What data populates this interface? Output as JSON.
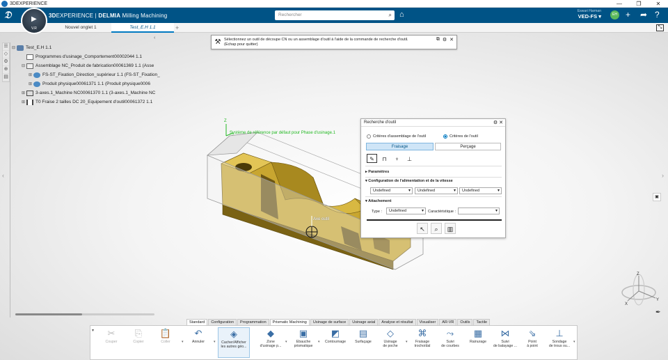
{
  "os": {
    "title": "3DEXPERIENCE",
    "controls": [
      "—",
      "❐",
      "✕"
    ]
  },
  "header": {
    "brand_bold": "3D",
    "brand_rest": "EXPERIENCE | ",
    "brand_app_bold": "DELMIA",
    "brand_app": " Milling Machining",
    "search_placeholder": "Rechercher",
    "user_name": "Eswari Harman",
    "workspace": "VED-FS ▾",
    "avatar": "EH",
    "compass_version": "V.R"
  },
  "tabs": [
    {
      "label": "Nouvel onglet 1"
    },
    {
      "label": "Test_E.H 1.1"
    }
  ],
  "tree": [
    {
      "label": "Test_E.H 1.1",
      "exp": "⊟"
    },
    {
      "label": "Programmes d'usinage_Comportement00002044 1.1",
      "exp": ""
    },
    {
      "label": "Assemblage NC_Produit de fabrication00061369 1.1 (Asse",
      "exp": "⊟"
    },
    {
      "label": "FS-ST_Fixation_Direction_supérieur 1.1 (FS-ST_Fixation_",
      "exp": "⊞"
    },
    {
      "label": "Produit physique00061371 1.1 (Produit physique0006",
      "exp": "⊞"
    },
    {
      "label": "3-axes.1_Machine NC00061370 1.1 (3-axes.1_Machine NC",
      "exp": "⊞"
    },
    {
      "label": "T0 Fraise 2 tailles DC 20_Equipement d'outil00061372 1.1",
      "exp": "⊞"
    }
  ],
  "notification": {
    "line1": "Sélectionnez un outil de découpe CN ou un assemblage d'outil à l'aide de la commande de recherche d'outil.",
    "line2": "(Echap pour quitter)"
  },
  "viewport": {
    "axis_label": "Système de référence par défaut pour Phase d'usinage.1",
    "tool_axis_label": "Axe outil",
    "part_color": "#c8a630"
  },
  "tool_panel": {
    "title": "Recherche d'outil",
    "radio_assembly": "Critères d'assemblage de l'outil",
    "radio_tool": "Critères de l'outil",
    "seg_milling": "Fraisage",
    "seg_drilling": "Perçage",
    "section_params": "Paramètres",
    "section_feed": "Configuration de l'alimentation et de la vitesse",
    "feed_values": [
      "Undefined",
      "Undefined",
      "Undefined"
    ],
    "section_attach": "Attachement",
    "type_label": "Type :",
    "type_value": "Undefined",
    "characteristic_label": "Caractéristique :",
    "characteristic_value": ""
  },
  "action_bar": {
    "tabs": [
      "Standard",
      "Configuration",
      "Programmation",
      "Prismatic Machining",
      "Usinage de surface",
      "Usinage axial",
      "Analyse et résultat",
      "Visualiser",
      "AR-VR",
      "Outils",
      "Tactile"
    ],
    "active_tab": "Prismatic Machining",
    "buttons": [
      {
        "l1": "Couper",
        "l2": "",
        "icon": "✂",
        "disabled": true
      },
      {
        "l1": "Copier",
        "l2": "",
        "icon": "⎘",
        "disabled": true
      },
      {
        "l1": "Coller",
        "l2": "",
        "icon": "📋",
        "disabled": true
      },
      {
        "l1": "Annuler",
        "l2": "",
        "icon": "↶",
        "disabled": false
      },
      {
        "l1": "Cacher/Afficher",
        "l2": "les autres géo...",
        "icon": "◈",
        "disabled": false
      },
      {
        "l1": "Zone",
        "l2": "d'usinage p...",
        "icon": "◆",
        "disabled": false
      },
      {
        "l1": "Ebauche",
        "l2": "prismatique",
        "icon": "▣",
        "disabled": false
      },
      {
        "l1": "Contournage",
        "l2": "",
        "icon": "◩",
        "disabled": false
      },
      {
        "l1": "Surfaçage",
        "l2": "",
        "icon": "▤",
        "disabled": false
      },
      {
        "l1": "Usinage",
        "l2": "de poche",
        "icon": "◇",
        "disabled": false
      },
      {
        "l1": "Fraisage",
        "l2": "trochoïdal",
        "icon": "⌘",
        "disabled": false
      },
      {
        "l1": "Suivi",
        "l2": "de courbes",
        "icon": "⤳",
        "disabled": false
      },
      {
        "l1": "Rainurage",
        "l2": "",
        "icon": "▦",
        "disabled": false
      },
      {
        "l1": "Suivi",
        "l2": "de balayage ...",
        "icon": "⋈",
        "disabled": false
      },
      {
        "l1": "Point",
        "l2": "à point",
        "icon": "⇘",
        "disabled": false
      },
      {
        "l1": "Sondage",
        "l2": "de trous ou...",
        "icon": "⊥",
        "disabled": false
      }
    ]
  }
}
